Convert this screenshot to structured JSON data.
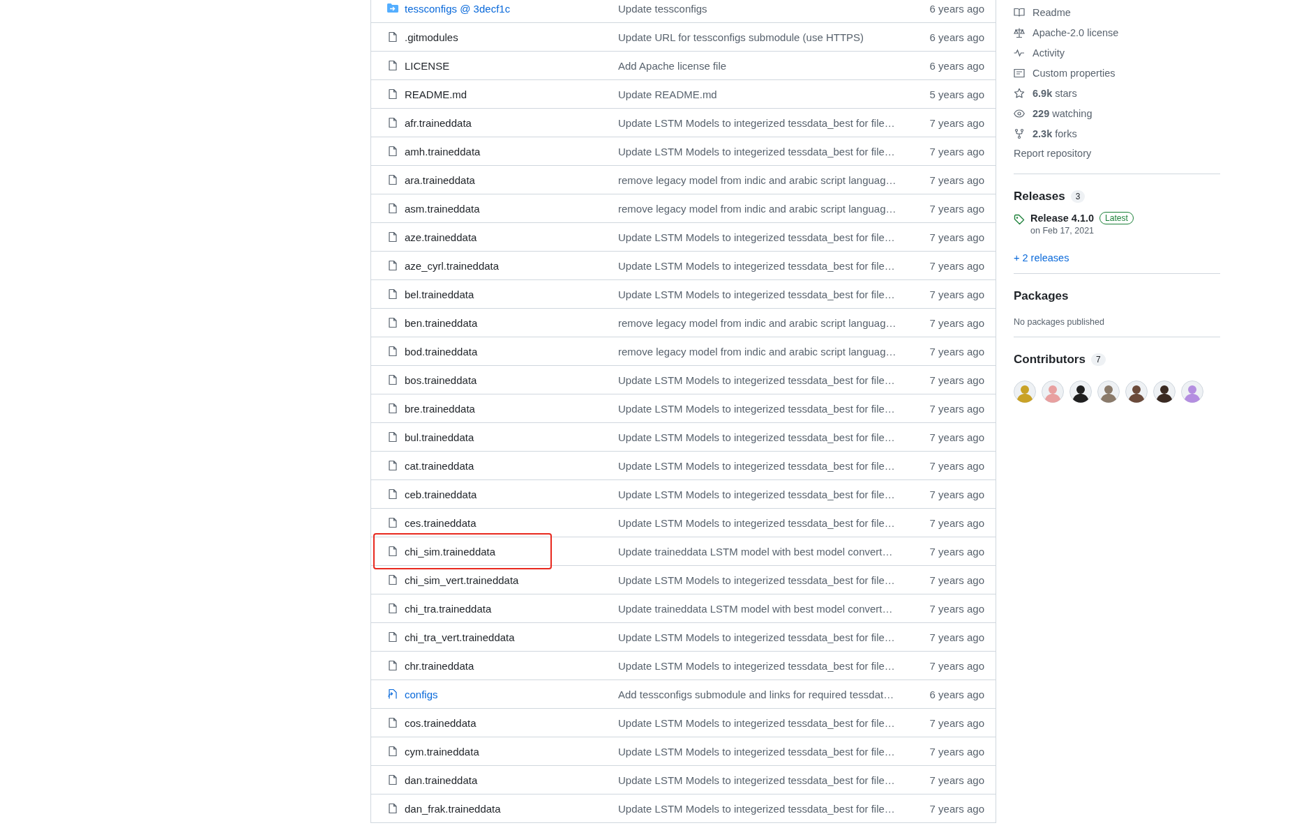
{
  "files": [
    {
      "kind": "submodule",
      "name": "tessconfigs @ 3decf1c",
      "message": "Update tessconfigs",
      "time": "6 years ago",
      "highlighted": false
    },
    {
      "kind": "file",
      "name": ".gitmodules",
      "message": "Update URL for tessconfigs submodule (use HTTPS)",
      "time": "6 years ago",
      "highlighted": false
    },
    {
      "kind": "file",
      "name": "LICENSE",
      "message": "Add Apache license file",
      "time": "6 years ago",
      "highlighted": false
    },
    {
      "kind": "file",
      "name": "README.md",
      "message": "Update README.md",
      "time": "5 years ago",
      "highlighted": false
    },
    {
      "kind": "file",
      "name": "afr.traineddata",
      "message": "Update LSTM Models to integerized tessdata_best for file…",
      "time": "7 years ago",
      "highlighted": false
    },
    {
      "kind": "file",
      "name": "amh.traineddata",
      "message": "Update LSTM Models to integerized tessdata_best for file…",
      "time": "7 years ago",
      "highlighted": false
    },
    {
      "kind": "file",
      "name": "ara.traineddata",
      "message": "remove legacy model from indic and arabic script languag…",
      "time": "7 years ago",
      "highlighted": false
    },
    {
      "kind": "file",
      "name": "asm.traineddata",
      "message": "remove legacy model from indic and arabic script languag…",
      "time": "7 years ago",
      "highlighted": false
    },
    {
      "kind": "file",
      "name": "aze.traineddata",
      "message": "Update LSTM Models to integerized tessdata_best for file…",
      "time": "7 years ago",
      "highlighted": false
    },
    {
      "kind": "file",
      "name": "aze_cyrl.traineddata",
      "message": "Update LSTM Models to integerized tessdata_best for file…",
      "time": "7 years ago",
      "highlighted": false
    },
    {
      "kind": "file",
      "name": "bel.traineddata",
      "message": "Update LSTM Models to integerized tessdata_best for file…",
      "time": "7 years ago",
      "highlighted": false
    },
    {
      "kind": "file",
      "name": "ben.traineddata",
      "message": "remove legacy model from indic and arabic script languag…",
      "time": "7 years ago",
      "highlighted": false
    },
    {
      "kind": "file",
      "name": "bod.traineddata",
      "message": "remove legacy model from indic and arabic script languag…",
      "time": "7 years ago",
      "highlighted": false
    },
    {
      "kind": "file",
      "name": "bos.traineddata",
      "message": "Update LSTM Models to integerized tessdata_best for file…",
      "time": "7 years ago",
      "highlighted": false
    },
    {
      "kind": "file",
      "name": "bre.traineddata",
      "message": "Update LSTM Models to integerized tessdata_best for file…",
      "time": "7 years ago",
      "highlighted": false
    },
    {
      "kind": "file",
      "name": "bul.traineddata",
      "message": "Update LSTM Models to integerized tessdata_best for file…",
      "time": "7 years ago",
      "highlighted": false
    },
    {
      "kind": "file",
      "name": "cat.traineddata",
      "message": "Update LSTM Models to integerized tessdata_best for file…",
      "time": "7 years ago",
      "highlighted": false
    },
    {
      "kind": "file",
      "name": "ceb.traineddata",
      "message": "Update LSTM Models to integerized tessdata_best for file…",
      "time": "7 years ago",
      "highlighted": false
    },
    {
      "kind": "file",
      "name": "ces.traineddata",
      "message": "Update LSTM Models to integerized tessdata_best for file…",
      "time": "7 years ago",
      "highlighted": false
    },
    {
      "kind": "file",
      "name": "chi_sim.traineddata",
      "message": "Update traineddata LSTM model with best model convert…",
      "time": "7 years ago",
      "highlighted": true
    },
    {
      "kind": "file",
      "name": "chi_sim_vert.traineddata",
      "message": "Update LSTM Models to integerized tessdata_best for file…",
      "time": "7 years ago",
      "highlighted": false
    },
    {
      "kind": "file",
      "name": "chi_tra.traineddata",
      "message": "Update traineddata LSTM model with best model convert…",
      "time": "7 years ago",
      "highlighted": false
    },
    {
      "kind": "file",
      "name": "chi_tra_vert.traineddata",
      "message": "Update LSTM Models to integerized tessdata_best for file…",
      "time": "7 years ago",
      "highlighted": false
    },
    {
      "kind": "file",
      "name": "chr.traineddata",
      "message": "Update LSTM Models to integerized tessdata_best for file…",
      "time": "7 years ago",
      "highlighted": false
    },
    {
      "kind": "symlink",
      "name": "configs",
      "message": "Add tessconfigs submodule and links for required tessdat…",
      "time": "6 years ago",
      "highlighted": false
    },
    {
      "kind": "file",
      "name": "cos.traineddata",
      "message": "Update LSTM Models to integerized tessdata_best for file…",
      "time": "7 years ago",
      "highlighted": false
    },
    {
      "kind": "file",
      "name": "cym.traineddata",
      "message": "Update LSTM Models to integerized tessdata_best for file…",
      "time": "7 years ago",
      "highlighted": false
    },
    {
      "kind": "file",
      "name": "dan.traineddata",
      "message": "Update LSTM Models to integerized tessdata_best for file…",
      "time": "7 years ago",
      "highlighted": false
    },
    {
      "kind": "file",
      "name": "dan_frak.traineddata",
      "message": "Update LSTM Models to integerized tessdata_best for file…",
      "time": "7 years ago",
      "highlighted": false
    }
  ],
  "about": [
    {
      "kind": "book",
      "label": "Readme"
    },
    {
      "kind": "scale",
      "label": "Apache-2.0 license"
    },
    {
      "kind": "pulse",
      "label": "Activity"
    },
    {
      "kind": "note",
      "label": "Custom properties"
    },
    {
      "kind": "star",
      "count": "6.9k",
      "label": "stars"
    },
    {
      "kind": "eye",
      "count": "229",
      "label": "watching"
    },
    {
      "kind": "fork",
      "count": "2.3k",
      "label": "forks"
    }
  ],
  "report_link": "Report repository",
  "releases": {
    "title": "Releases",
    "count": "3",
    "latest_name": "Release 4.1.0",
    "latest_badge": "Latest",
    "latest_date": "on Feb 17, 2021",
    "more_link": "+ 2 releases"
  },
  "packages": {
    "title": "Packages",
    "note": "No packages published"
  },
  "contributors": {
    "title": "Contributors",
    "count": "7",
    "avatars": [
      {
        "color": "#c9a227"
      },
      {
        "color": "#e8a0a0"
      },
      {
        "color": "#1f1f1f"
      },
      {
        "color": "#8a7a6a"
      },
      {
        "color": "#6b4a3a"
      },
      {
        "color": "#3a2a22"
      },
      {
        "color": "#b48ee0"
      }
    ]
  }
}
